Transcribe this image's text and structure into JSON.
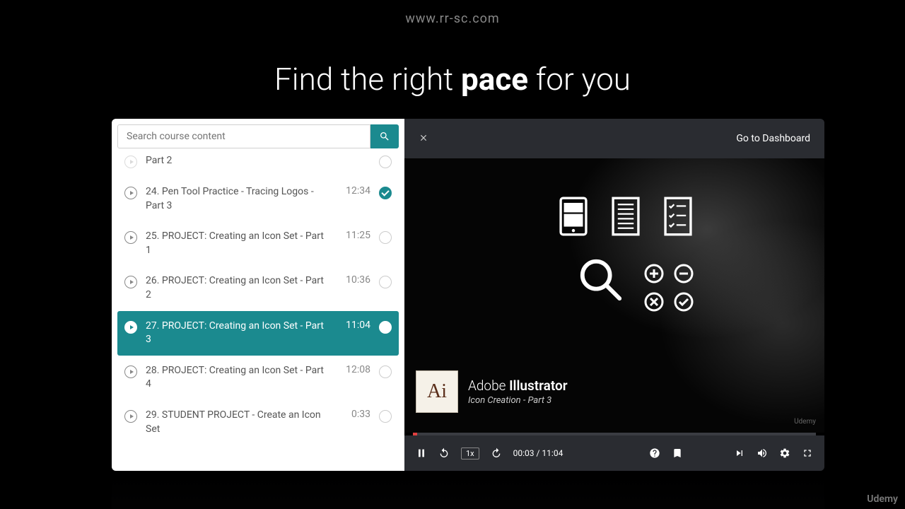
{
  "watermark_url": "www.rr-sc.com",
  "headline": {
    "pre": "Find the right ",
    "bold": "pace",
    "post": " for you"
  },
  "search": {
    "placeholder": "Search course content"
  },
  "lessons": {
    "partial_top": "Part 2",
    "items": [
      {
        "title": "24. Pen Tool Practice - Tracing Logos - Part 3",
        "duration": "12:34",
        "status": "completed"
      },
      {
        "title": "25. PROJECT: Creating an Icon Set - Part 1",
        "duration": "11:25",
        "status": "none"
      },
      {
        "title": "26. PROJECT: Creating an Icon Set - Part 2",
        "duration": "10:36",
        "status": "none"
      },
      {
        "title": "27. PROJECT: Creating an Icon Set - Part 3",
        "duration": "11:04",
        "status": "current"
      },
      {
        "title": "28. PROJECT: Creating an Icon Set - Part 4",
        "duration": "12:08",
        "status": "none"
      },
      {
        "title": "29. STUDENT PROJECT - Create an Icon Set",
        "duration": "0:33",
        "status": "none"
      }
    ]
  },
  "header": {
    "dashboard": "Go to Dashboard"
  },
  "video": {
    "ai_logo": "Ai",
    "ai_title_a": "Adobe ",
    "ai_title_b": "Illustrator",
    "ai_subtitle": "Icon Creation - Part 3",
    "small_brand": "Udemy"
  },
  "controls": {
    "speed": "1x",
    "time": "00:03 / 11:04"
  },
  "brand": "Udemy"
}
